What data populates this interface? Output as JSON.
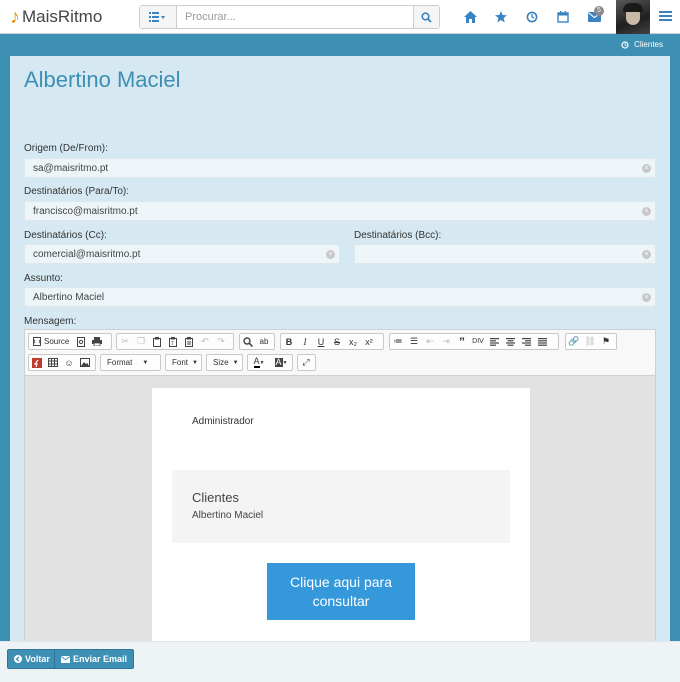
{
  "app": {
    "logo_text": "MaisRitmo"
  },
  "search": {
    "placeholder": "Procurar..."
  },
  "nav": {
    "messages_badge": "5",
    "icons": [
      "home-icon",
      "star-icon",
      "clock-icon",
      "calendar-icon",
      "envelope-icon",
      "menu-icon"
    ]
  },
  "breadcrumb": {
    "label": "Clientes"
  },
  "page": {
    "title": "Albertino Maciel"
  },
  "form": {
    "from_label": "Origem (De/From):",
    "from_value": "sa@maisritmo.pt",
    "to_label": "Destinatários (Para/To):",
    "to_value": "francisco@maisritmo.pt",
    "cc_label": "Destinatários (Cc):",
    "cc_value": "comercial@maisritmo.pt",
    "bcc_label": "Destinatários (Bcc):",
    "bcc_value": "",
    "subject_label": "Assunto:",
    "subject_value": "Albertino Maciel",
    "message_label": "Mensagem:"
  },
  "toolbar": {
    "source_label": "Source",
    "format_label": "Format",
    "font_label": "Font",
    "size_label": "Size"
  },
  "email": {
    "greeting": "Administrador",
    "box_title": "Clientes",
    "box_subtitle": "Albertino Maciel",
    "cta_label": "Clique aqui para consultar"
  },
  "footer": {
    "back_label": "Voltar",
    "send_label": "Enviar Email"
  },
  "colors": {
    "accent": "#3d8fb3",
    "cta": "#3498db",
    "logo_note": "#e8910c"
  }
}
